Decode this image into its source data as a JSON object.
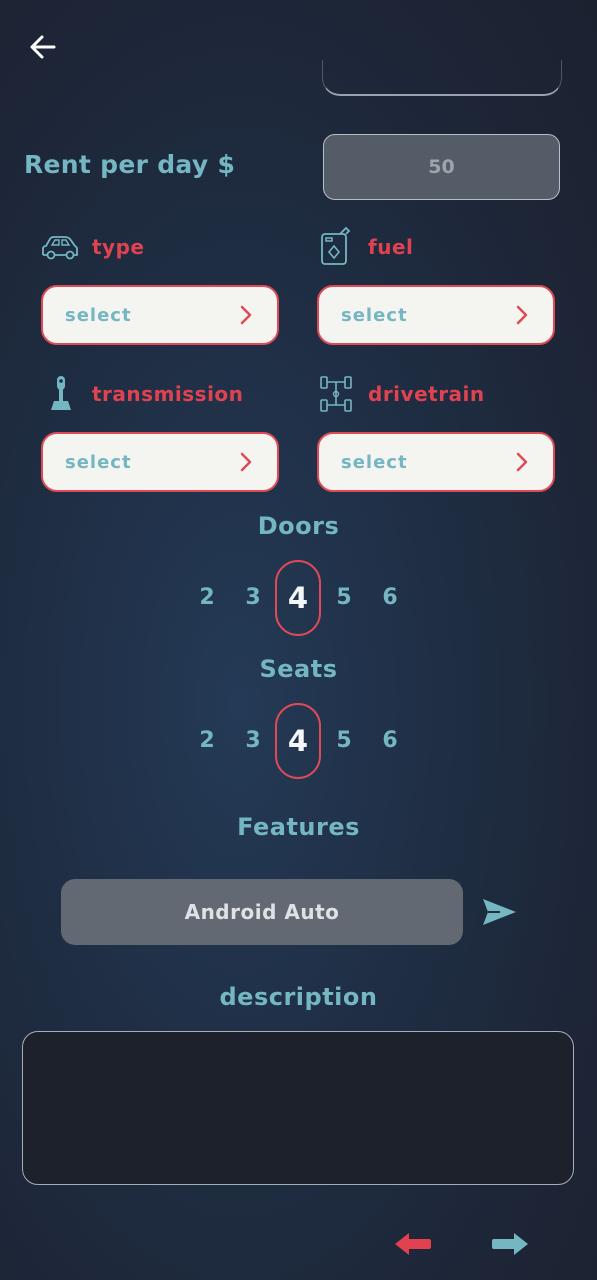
{
  "rent": {
    "label": "Rent per day $",
    "value": "50"
  },
  "options": [
    {
      "key": "type",
      "label": "type",
      "icon": "car-icon",
      "value": "select"
    },
    {
      "key": "fuel",
      "label": "fuel",
      "icon": "fuel-can-icon",
      "value": "select"
    },
    {
      "key": "transmission",
      "label": "transmission",
      "icon": "gear-stick-icon",
      "value": "select"
    },
    {
      "key": "drivetrain",
      "label": "drivetrain",
      "icon": "drivetrain-icon",
      "value": "select"
    }
  ],
  "doors": {
    "title": "Doors",
    "values": [
      "2",
      "3",
      "4",
      "5",
      "6"
    ],
    "selected": "4"
  },
  "seats": {
    "title": "Seats",
    "values": [
      "2",
      "3",
      "4",
      "5",
      "6"
    ],
    "selected": "4"
  },
  "features": {
    "title": "Features",
    "input_value": "Android Auto"
  },
  "description": {
    "title": "description",
    "value": ""
  },
  "colors": {
    "accent": "#74b6c2",
    "danger": "#e0434f",
    "select_bg": "#f4f4f0"
  },
  "icons": {
    "back": "arrow-left-icon",
    "send": "send-icon",
    "prev": "arrow-left-red-icon",
    "next": "arrow-right-teal-icon"
  }
}
